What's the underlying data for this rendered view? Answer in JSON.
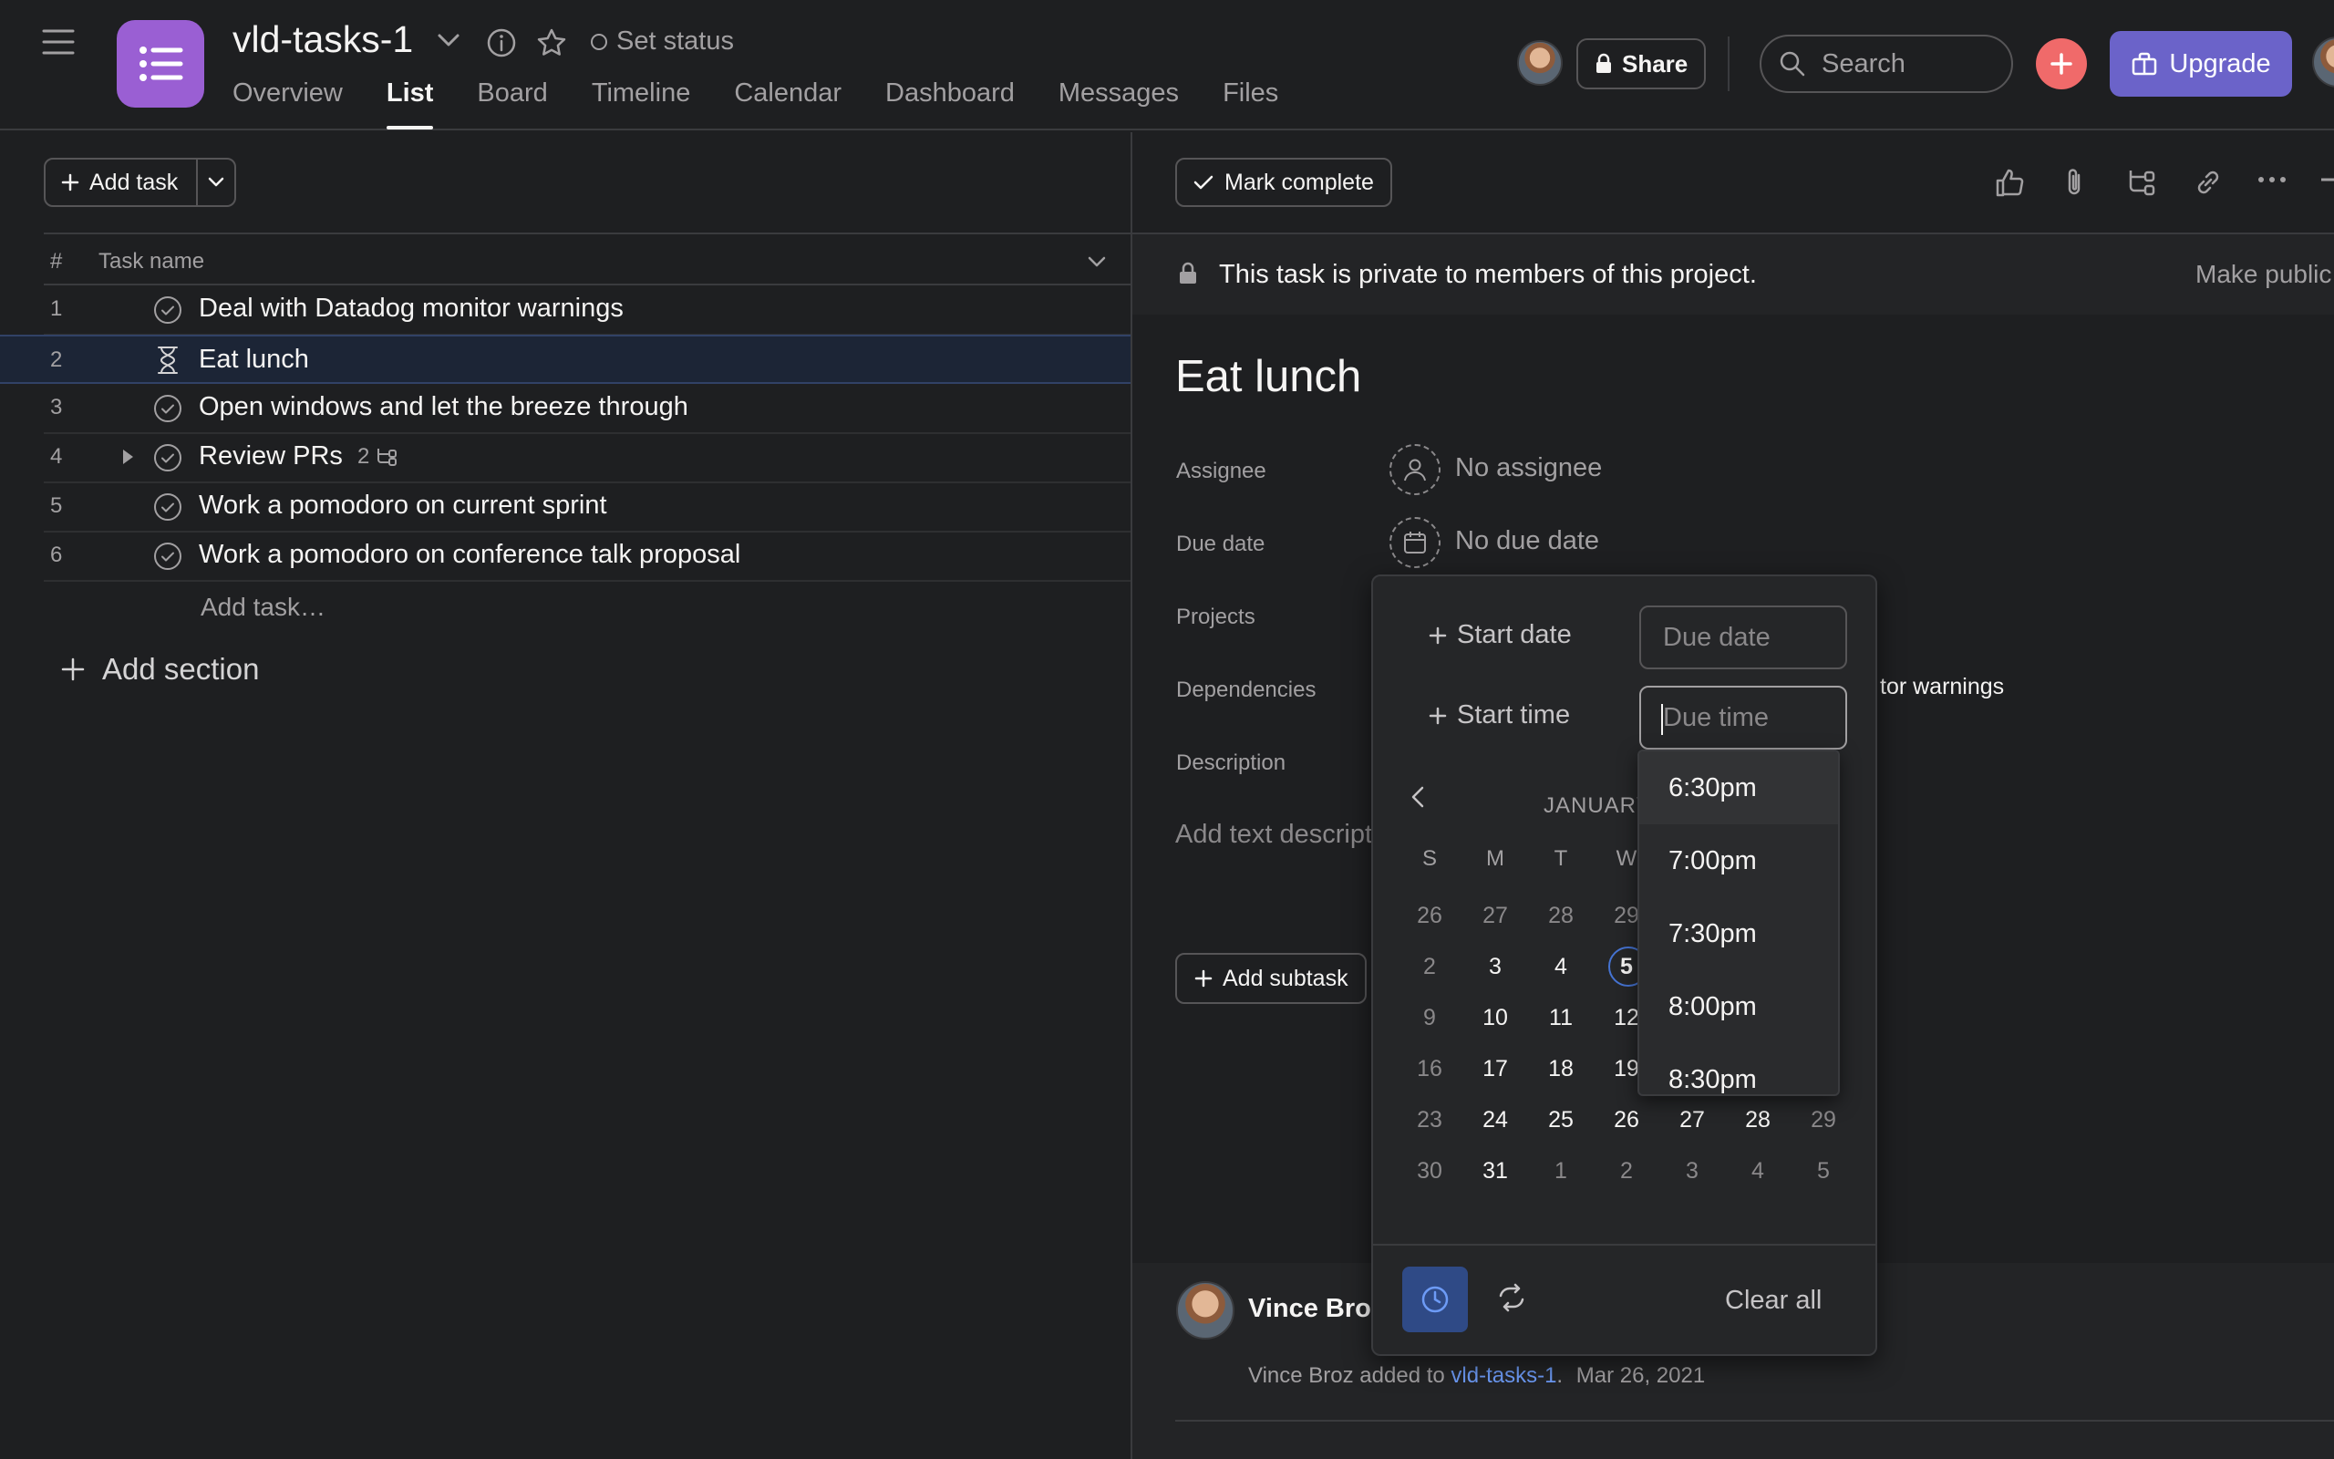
{
  "project": {
    "title": "vld-tasks-1",
    "set_status": "Set status",
    "tabs": [
      "Overview",
      "List",
      "Board",
      "Timeline",
      "Calendar",
      "Dashboard",
      "Messages",
      "Files"
    ],
    "active_tab": "List",
    "icon_color": "#9a5fd3"
  },
  "header": {
    "share_label": "Share",
    "search_placeholder": "Search",
    "upgrade_label": "Upgrade",
    "accent_upgrade": "#6b63c9",
    "accent_create": "#f06a6a"
  },
  "list": {
    "add_task_label": "Add task",
    "col_num": "#",
    "col_task_name": "Task name",
    "tasks": [
      {
        "num": "1",
        "name": "Deal with Datadog monitor warnings",
        "icon": "check-circle-icon"
      },
      {
        "num": "2",
        "name": "Eat lunch",
        "icon": "hourglass-icon"
      },
      {
        "num": "3",
        "name": "Open windows and let the breeze through",
        "icon": "check-circle-icon"
      },
      {
        "num": "4",
        "name": "Review PRs",
        "icon": "check-circle-icon",
        "subtask_count": "2"
      },
      {
        "num": "5",
        "name": "Work a pomodoro on current sprint",
        "icon": "check-circle-icon"
      },
      {
        "num": "6",
        "name": "Work a pomodoro on conference talk proposal",
        "icon": "check-circle-icon"
      }
    ],
    "add_task_placeholder": "Add task…",
    "add_section_label": "Add section"
  },
  "detail": {
    "mark_complete_label": "Mark complete",
    "private_notice": "This task is private to members of this project.",
    "make_public_label": "Make public",
    "title": "Eat lunch",
    "fields": {
      "assignee_label": "Assignee",
      "assignee_value": "No assignee",
      "due_date_label": "Due date",
      "due_date_value": "No due date",
      "projects_label": "Projects",
      "dependencies_label": "Dependencies",
      "dependencies_value_visible": "tor warnings",
      "description_label": "Description"
    },
    "description_placeholder": "Add text descript",
    "add_subtask_label": "Add subtask",
    "activity": {
      "author": "Vince Broz",
      "actor": "Vince Broz",
      "verb": "added to",
      "project_link": "vld-tasks-1",
      "period": ".",
      "date": "Mar 26, 2021"
    }
  },
  "datepicker": {
    "start_date_label": "Start date",
    "start_time_label": "Start time",
    "due_date_placeholder": "Due date",
    "due_time_placeholder": "Due time",
    "month_label": "JANUARY",
    "weekdays": [
      "S",
      "M",
      "T",
      "W"
    ],
    "weeks": [
      [
        "26",
        "27",
        "28",
        "29"
      ],
      [
        "2",
        "3",
        "4",
        "5"
      ],
      [
        "9",
        "10",
        "11",
        "12"
      ],
      [
        "16",
        "17",
        "18",
        "19"
      ],
      [
        "23",
        "24",
        "25",
        "26",
        "27",
        "28",
        "29"
      ],
      [
        "30",
        "31",
        "1",
        "2",
        "3",
        "4",
        "5"
      ]
    ],
    "today": "5",
    "time_options": [
      "6:30pm",
      "7:00pm",
      "7:30pm",
      "8:00pm",
      "8:30pm"
    ],
    "highlighted_time": "6:30pm",
    "clear_all_label": "Clear all",
    "accent_today": "#4573d2"
  }
}
